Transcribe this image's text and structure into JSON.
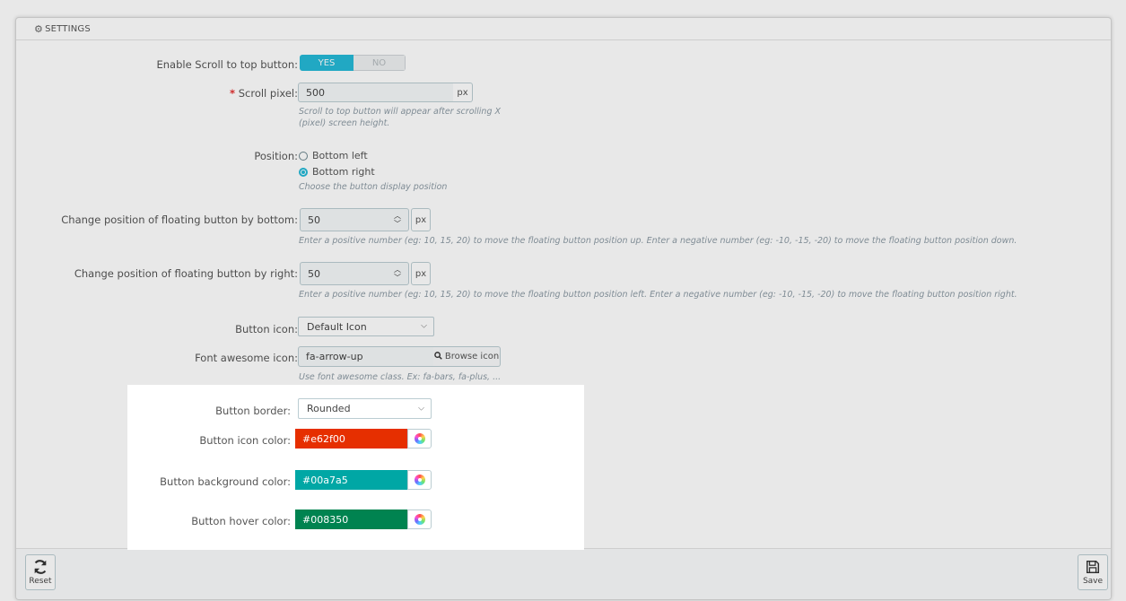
{
  "header": {
    "icon": "cogs-icon",
    "title": "SETTINGS"
  },
  "fields": {
    "enable_scroll": {
      "label": "Enable Scroll to top button:",
      "yes": "YES",
      "no": "NO",
      "value": "YES"
    },
    "scroll_pixel": {
      "required_mark": "*",
      "label": "Scroll pixel:",
      "value": "500",
      "unit": "px",
      "help_line1": "Scroll to top button will appear after scrolling X",
      "help_line2": "(pixel) screen height."
    },
    "position": {
      "label": "Position:",
      "options": [
        "Bottom left",
        "Bottom right"
      ],
      "selected": "Bottom right",
      "help": "Choose the button display position"
    },
    "pos_bottom": {
      "label": "Change position of floating button by bottom:",
      "value": "50",
      "unit": "px",
      "help": "Enter a positive number (eg: 10, 15, 20) to move the floating button position up. Enter a negative number (eg: -10, -15, -20) to move the floating button position down."
    },
    "pos_right": {
      "label": "Change position of floating button by right:",
      "value": "50",
      "unit": "px",
      "help": "Enter a positive number (eg: 10, 15, 20) to move the floating button position left. Enter a negative number (eg: -10, -15, -20) to move the floating button position right."
    },
    "button_icon": {
      "label": "Button icon:",
      "value": "Default Icon"
    },
    "fa_icon": {
      "label": "Font awesome icon:",
      "value": "fa-arrow-up",
      "browse": "Browse icon",
      "help": "Use font awesome class. Ex: fa-bars, fa-plus, ..."
    },
    "button_border": {
      "label": "Button border:",
      "value": "Rounded"
    },
    "icon_color": {
      "label": "Button icon color:",
      "value": "#e62f00",
      "color": "#e62f00"
    },
    "bg_color": {
      "label": "Button background color:",
      "value": "#00a7a5",
      "color": "#00a7a5"
    },
    "hover_color": {
      "label": "Button hover color:",
      "value": "#008350",
      "color": "#008350"
    }
  },
  "footer": {
    "reset": "Reset",
    "save": "Save"
  }
}
